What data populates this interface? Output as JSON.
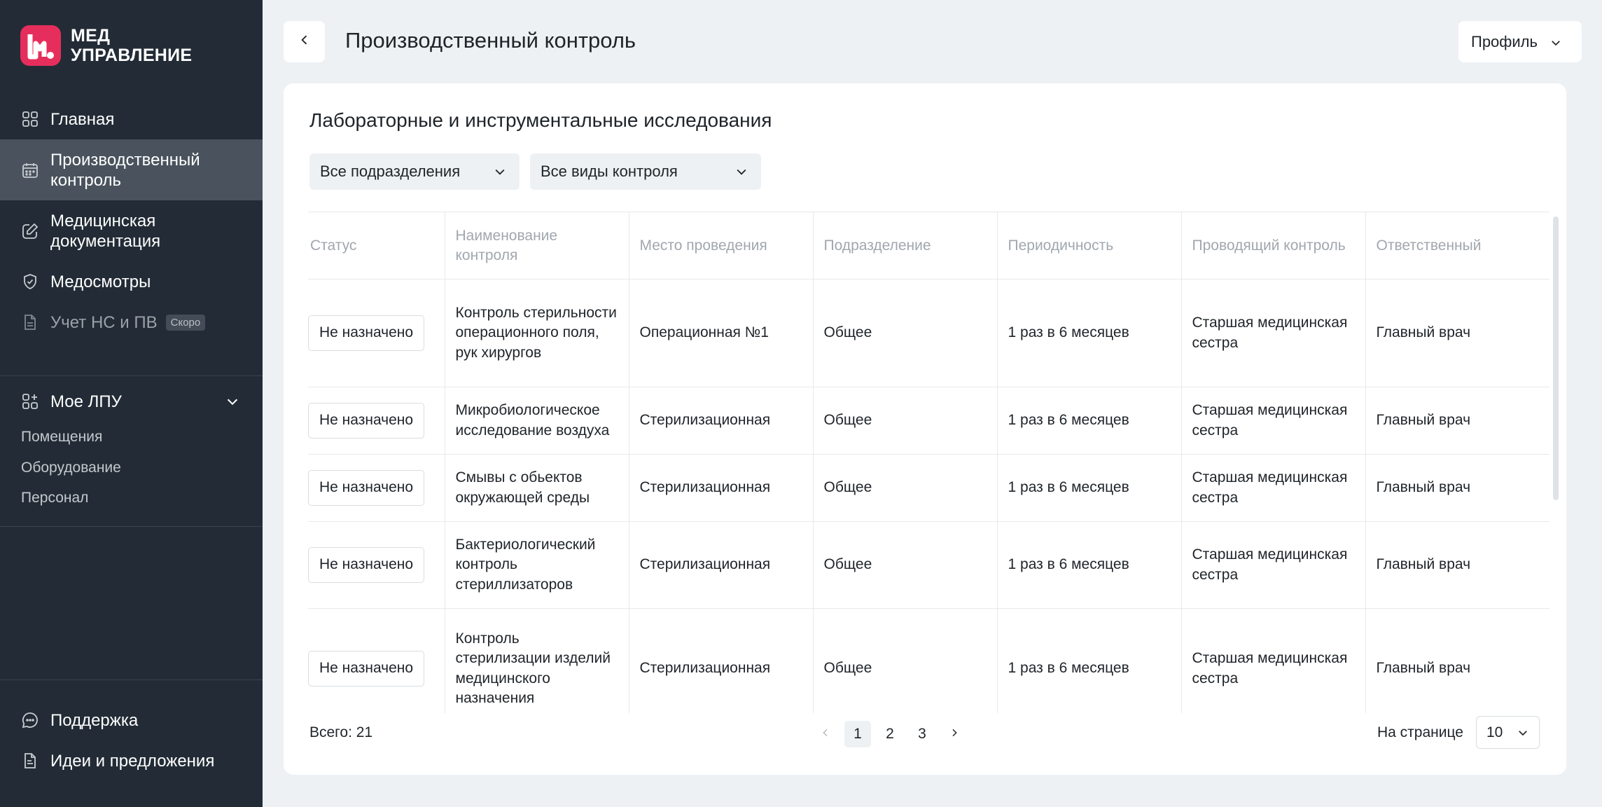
{
  "sidebar": {
    "logo": {
      "line1": "МЕД",
      "line2": "УПРАВЛЕНИЕ"
    },
    "nav": [
      {
        "label": "Главная",
        "icon": "grid-icon"
      },
      {
        "label": "Производственный контроль",
        "icon": "calendar-icon",
        "active": true
      },
      {
        "label": "Медицинская документация",
        "icon": "edit-icon"
      },
      {
        "label": "Медосмотры",
        "icon": "shield-check-icon"
      },
      {
        "label": "Учет НС и ПВ",
        "icon": "document-icon",
        "badge": "Скоро"
      }
    ],
    "lpu": {
      "label": "Мое ЛПУ",
      "items": [
        "Помещения",
        "Оборудование",
        "Персонал"
      ]
    },
    "bottom": [
      {
        "label": "Поддержка",
        "icon": "chat-icon"
      },
      {
        "label": "Идеи и предложения",
        "icon": "idea-doc-icon"
      }
    ]
  },
  "header": {
    "title": "Производственный контроль",
    "profile": "Профиль"
  },
  "card": {
    "title": "Лабораторные и инструментальные исследования",
    "filters": {
      "division": "Все подразделения",
      "control_type": "Все виды контроля"
    },
    "columns": [
      "Статус",
      "Наименование контроля",
      "Место проведения",
      "Подразделение",
      "Периодичность",
      "Проводящий контроль",
      "Ответственный"
    ],
    "rows": [
      {
        "status": "Не назначено",
        "name": "Контроль стерильности операционного поля, рук хирургов",
        "place": "Операционная №1",
        "division": "Общее",
        "period": "1 раз в 6 месяцев",
        "conductor": "Старшая медицинская сестра",
        "responsible": "Главный врач"
      },
      {
        "status": "Не назначено",
        "name": "Микробиологическое исследование воздуха",
        "place": "Стерилизационная",
        "division": "Общее",
        "period": "1 раз в 6 месяцев",
        "conductor": "Старшая медицинская сестра",
        "responsible": "Главный врач"
      },
      {
        "status": "Не назначено",
        "name": "Смывы с обьектов окружающей среды",
        "place": "Стерилизационная",
        "division": "Общее",
        "period": "1 раз в 6 месяцев",
        "conductor": "Старшая медицинская сестра",
        "responsible": "Главный врач"
      },
      {
        "status": "Не назначено",
        "name": "Бактериологический контроль стериллизаторов",
        "place": "Стерилизационная",
        "division": "Общее",
        "period": "1 раз в 6 месяцев",
        "conductor": "Старшая медицинская сестра",
        "responsible": "Главный врач"
      },
      {
        "status": "Не назначено",
        "name": "Контроль стерилизации изделий медицинского назначения",
        "place": "Стерилизационная",
        "division": "Общее",
        "period": "1 раз в 6 месяцев",
        "conductor": "Старшая медицинская сестра",
        "responsible": "Главный врач"
      }
    ],
    "footer": {
      "total": "Всего: 21",
      "pages": [
        "1",
        "2",
        "3"
      ],
      "current_page": "1",
      "per_page_label": "На странице",
      "per_page": "10"
    }
  },
  "colors": {
    "sidebar_bg": "#232c36",
    "active_bg": "#4a535d",
    "brand": "#e62e5c",
    "page_bg": "#eef1f4"
  }
}
